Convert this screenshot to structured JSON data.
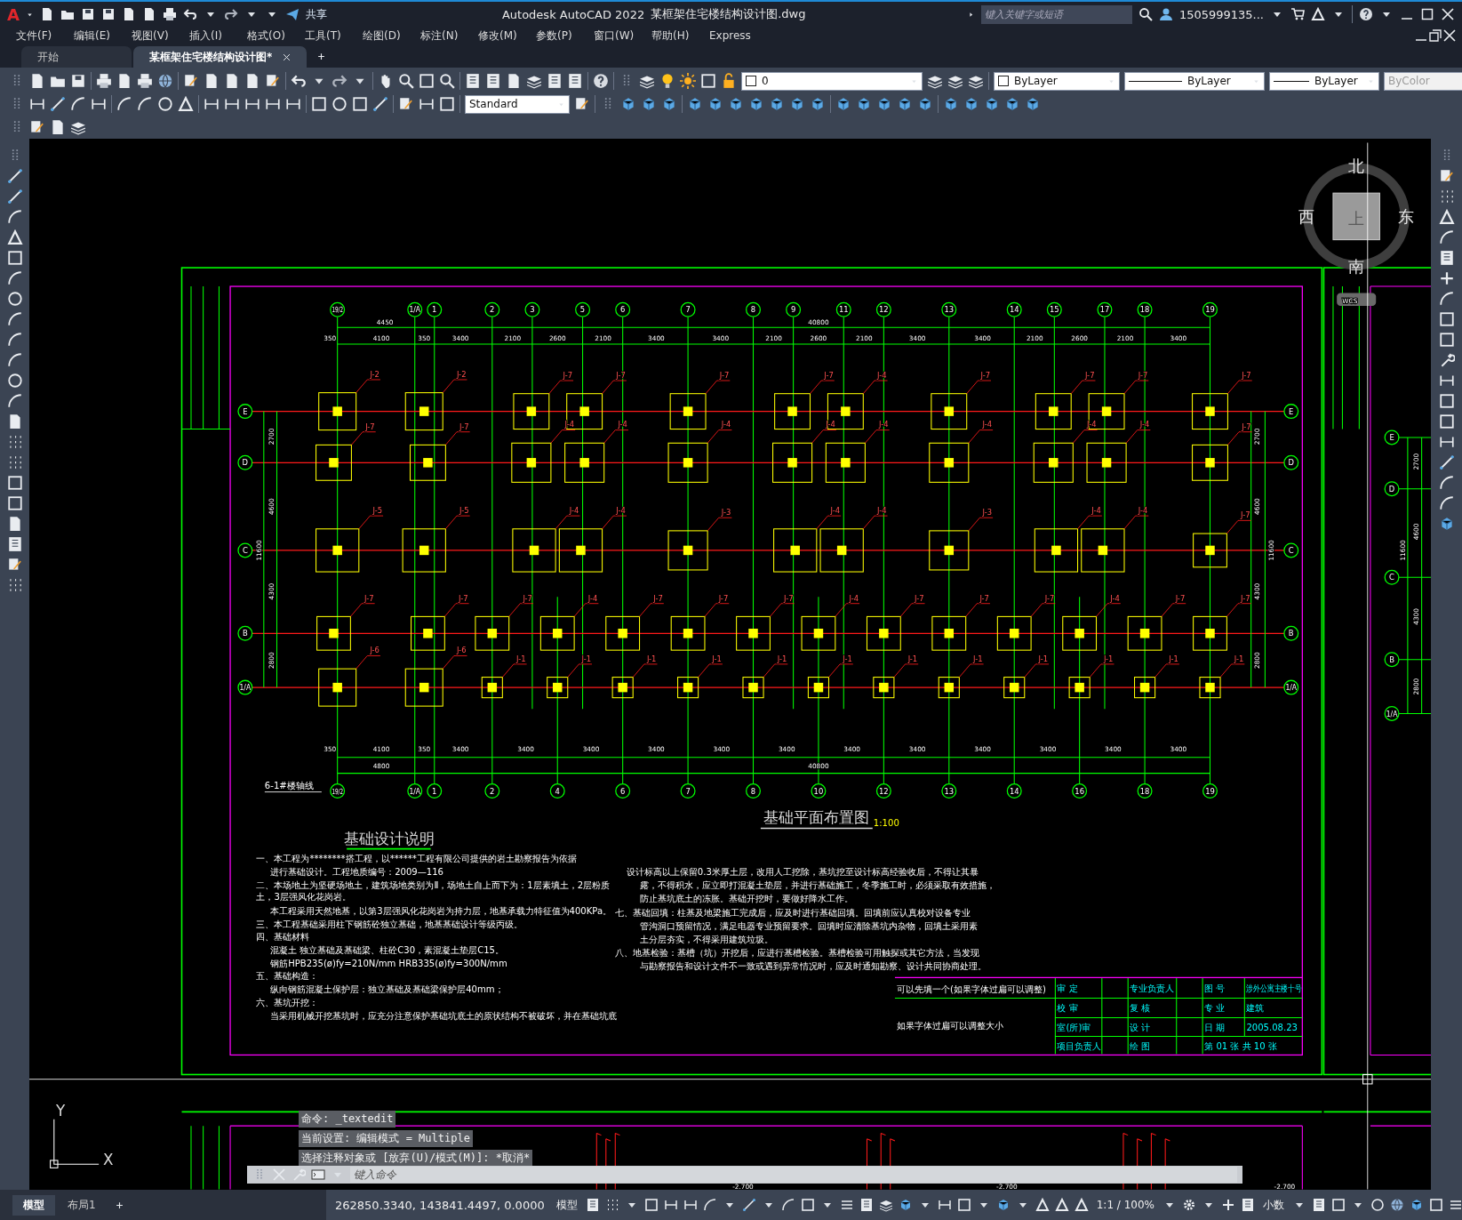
{
  "title_bar": {
    "logo": "A",
    "share": "共享",
    "app_title": "Autodesk AutoCAD 2022",
    "file_name": "某框架住宅楼结构设计图.dwg",
    "search": {
      "placeholder": "键入关键字或短语"
    },
    "user": "1505999135..."
  },
  "menu": [
    "文件(F)",
    "编辑(E)",
    "视图(V)",
    "插入(I)",
    "格式(O)",
    "工具(T)",
    "绘图(D)",
    "标注(N)",
    "修改(M)",
    "参数(P)",
    "窗口(W)",
    "帮助(H)",
    "Express"
  ],
  "doc_tabs": [
    {
      "label": "开始",
      "selected": false
    },
    {
      "label": "某框架住宅楼结构设计图*",
      "selected": true
    }
  ],
  "toolbar": {
    "layer": "0",
    "text_style": "Standard",
    "color_setting": "ByLayer",
    "linetype": "ByLayer",
    "lineweight": "ByLayer",
    "plot_style": {
      "value": "ByColor",
      "disabled": true
    }
  },
  "viewcube": {
    "north": "北",
    "west": "西",
    "east": "东",
    "south": "南",
    "face": "上",
    "ucs": "WCS"
  },
  "drawing": {
    "top_axes": [
      "19/2",
      "1/A",
      "1",
      "2",
      "3",
      "5",
      "6",
      "7",
      "8",
      "9",
      "11",
      "12",
      "13",
      "14",
      "15",
      "17",
      "18",
      "19"
    ],
    "top_overall": [
      "4450",
      "40800"
    ],
    "top_spans": [
      "350",
      "4100",
      "350",
      "3400",
      "2100",
      "2600",
      "2100",
      "3400",
      "3400",
      "2100",
      "2600",
      "2100",
      "3400",
      "3400",
      "2100",
      "2600",
      "2100",
      "3400"
    ],
    "rows": [
      {
        "label": "E",
        "label_right": "E",
        "footings": [
          "J-2",
          "J-2",
          "J-7",
          "J-7",
          "J-7",
          "J-7",
          "J-4",
          "J-7",
          "J-7",
          "J-7",
          "J-7"
        ]
      },
      {
        "label": "D",
        "label_right": "D",
        "footings": [
          "J-7",
          "J-7",
          "J-4",
          "J-4",
          "J-4",
          "J-4",
          "J-4",
          "J-4",
          "J-4",
          "J-4",
          "J-7"
        ]
      },
      {
        "label": "C",
        "label_right": "C",
        "footings": [
          "J-5",
          "J-5",
          "J-4",
          "J-4",
          "J-3",
          "J-4",
          "J-4",
          "J-3",
          "J-4",
          "J-4",
          "J-7"
        ]
      },
      {
        "label": "B",
        "label_right": "B",
        "footings": [
          "J-7",
          "J-7",
          "J-7",
          "J-4",
          "J-7",
          "J-7",
          "J-7",
          "J-4",
          "J-7",
          "J-7",
          "J-7",
          "J-4",
          "J-7",
          "J-7"
        ]
      },
      {
        "label": "1/A",
        "label_right": "1/A",
        "footings": [
          "J-6",
          "J-6",
          "J-1",
          "J-1",
          "J-1",
          "J-1",
          "J-1",
          "J-1",
          "J-1",
          "J-1",
          "J-1",
          "J-1",
          "J-1",
          "J-1"
        ]
      }
    ],
    "left_dims": [
      "2700",
      "4600",
      "4300",
      "2800"
    ],
    "left_total": "11600",
    "right_dims": [
      "2700",
      "4600",
      "4300",
      "2800"
    ],
    "right_total": "11600",
    "bottom_spans": [
      "350",
      "4100",
      "350",
      "3400",
      "3400",
      "3400",
      "3400",
      "3400",
      "3400",
      "3400",
      "3400",
      "3400",
      "3400",
      "3400",
      "3400"
    ],
    "bottom_overall": [
      "4800",
      "40800"
    ],
    "bottom_axes": [
      "19/2",
      "1/A",
      "1",
      "2",
      "4",
      "6",
      "7",
      "8",
      "10",
      "12",
      "13",
      "14",
      "16",
      "18",
      "19"
    ],
    "axis_note": "6-1#楼轴线",
    "plan_title": "基础平面布置图",
    "plan_scale": "1:100",
    "notes_title": "基础设计说明",
    "notes_left": [
      "一、本工程为********搭工程，以******工程有限公司提供的岩土勘察报告为依据",
      "进行基础设计。工程地质编号：2009—116",
      "二、本场地土为坚硬场地土，建筑场地类别为Ⅱ，场地土自上而下为：1层素填土，2层粉质土，3层强风化花岗岩。",
      "本工程采用天然地基，以第3层强风化花岗岩为持力层，地基承载力特征值为400KPa。",
      "三、本工程基础采用柱下钢筋砼独立基础，地基基础设计等级丙级。",
      "四、基础材料",
      "混凝土  独立基础及基础梁、柱砼C30，素混凝土垫层C15。",
      "钢筋HPB235(ø)fy=210N/mm  HRB335(ø)fy=300N/mm",
      "五、基础构造：",
      "纵向钢筋混凝土保护层：独立基础及基础梁保护层40mm；",
      "六、基坑开挖：",
      "当采用机械开挖基坑时，应充分注意保护基础坑底土的原状结构不被破坏，并在基础坑底"
    ],
    "notes_right": [
      "设计标高以上保留0.3米厚土层，改用人工挖除，基坑挖至设计标高经验收后，不得让其暴",
      "露，不得积水，应立即打混凝土垫层，并进行基础施工，冬季施工时，必须采取有效措施，",
      "防止基坑底土的冻胀。基础开挖时，要做好降水工作。",
      "七、基础回填：柱基及地梁施工完成后，应及时进行基础回填。回填前应认真校对设备专业",
      "管沟洞口预留情况，满足电器专业预留要求。回填时应清除基坑内杂物，回填土采用素",
      "土分层夯实，不得采用建筑垃圾。",
      "八、地基检验：基槽（坑）开挖后，应进行基槽检验。基槽检验可用触探或其它方法，当发现",
      "与勘察报告和设计文件不一致或遇到异常情况时，应及时通知勘察、设计共同协商处理。"
    ],
    "title_block": {
      "remark_1": "可以先填一个(如果字体过扁可以调整)",
      "remark_2": "如果字体过扁可以调整大小",
      "rows": [
        {
          "signoff": [
            "审  定",
            "专业负责人"
          ],
          "info": [
            "图  号",
            "涉外公寓主楼十号"
          ]
        },
        {
          "signoff": [
            "校  审",
            "复  核"
          ],
          "info": [
            "专  业",
            "建筑"
          ]
        },
        {
          "signoff": [
            "室(所)审",
            "设  计"
          ],
          "info": [
            "日  期",
            "2005.08.23"
          ]
        },
        {
          "signoff": [
            "项目负责人",
            "绘  图"
          ],
          "info": [
            "第 01 张  共 10 张"
          ]
        }
      ]
    },
    "next_sheet": {
      "rows": [
        "E",
        "D",
        "C",
        "B",
        "1/A"
      ],
      "dims": [
        "2700",
        "4600",
        "4300",
        "2800"
      ],
      "total": "11600"
    },
    "lower_sheet": {
      "levels": [
        "-2.700",
        "-2.700",
        "-2.700"
      ]
    }
  },
  "ucs": {
    "x": "X",
    "y": "Y"
  },
  "command_line": {
    "history": [
      "命令: _textedit",
      "当前设置: 编辑模式 = Multiple",
      "选择注释对象或 [放弃(U)/模式(M)]: *取消*"
    ],
    "placeholder": "键入命令"
  },
  "layout_tabs": [
    {
      "label": "模型",
      "selected": true
    },
    {
      "label": "布局1",
      "selected": false
    }
  ],
  "status_bar": {
    "coordinates": "262850.3340, 143841.4497, 0.0000",
    "space": "模型",
    "scale": "1:1 / 100%",
    "units": "小数"
  }
}
